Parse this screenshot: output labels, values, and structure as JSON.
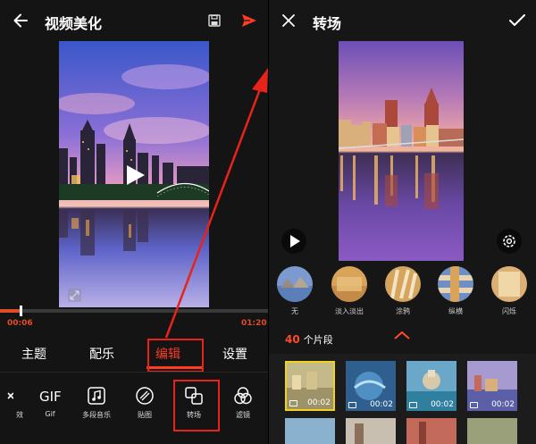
{
  "left_screen": {
    "title": "视频美化",
    "time_current": "00:06",
    "time_total": "01:20",
    "progress": 0.075,
    "tabs": [
      "主题",
      "配乐",
      "编辑",
      "设置"
    ],
    "active_tab": "编辑",
    "tools": [
      {
        "label": "效",
        "icon": "effects-icon"
      },
      {
        "label": "Gif",
        "icon": "gif-icon"
      },
      {
        "label": "多段音乐",
        "icon": "music-icon"
      },
      {
        "label": "贴图",
        "icon": "sticker-icon"
      },
      {
        "label": "转场",
        "icon": "transition-icon"
      },
      {
        "label": "滤镜",
        "icon": "filter-icon"
      }
    ]
  },
  "right_screen": {
    "title": "转场",
    "transitions": [
      {
        "label": "无"
      },
      {
        "label": "淡入淡出"
      },
      {
        "label": "涂鸦"
      },
      {
        "label": "纵横"
      },
      {
        "label": "闪烁"
      }
    ],
    "clip_count": "40",
    "clip_count_suffix": "个片段",
    "clips": [
      {
        "duration": "00:02"
      },
      {
        "duration": "00:02"
      },
      {
        "duration": "00:02"
      },
      {
        "duration": "00:02"
      }
    ]
  },
  "colors": {
    "accent": "#ff3c22",
    "annotation_red": "#e8231a",
    "background": "#141414"
  }
}
